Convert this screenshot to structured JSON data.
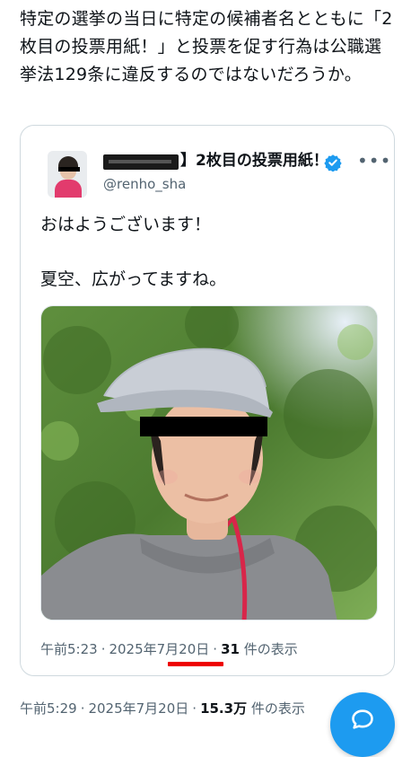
{
  "outer_post": {
    "text": "特定の選挙の当日に特定の候補者名とともに「2枚目の投票用紙！」と投票を促す行為は公職選挙法129条に違反するのではないだろうか。",
    "time": "午前5:29",
    "date": "2025年7月20日",
    "views_count": "15.3万",
    "views_label": "件の表示"
  },
  "quoted_post": {
    "display_name": "】2枚目の投票用紙！",
    "handle": "@renho_sha",
    "text_line1": "おはようございます！",
    "text_line2": "夏空、広がってますね。",
    "time": "午前5:23",
    "date": "2025年7月20日",
    "views_count": "31",
    "views_label": "件の表示"
  },
  "icons": {
    "verified": "verified-badge-icon",
    "more": "more-options-icon",
    "reply_fab": "reply-bubble-icon"
  },
  "colors": {
    "accent": "#1d9bf0",
    "secondary_text": "#536471",
    "highlight": "#ee0000"
  }
}
